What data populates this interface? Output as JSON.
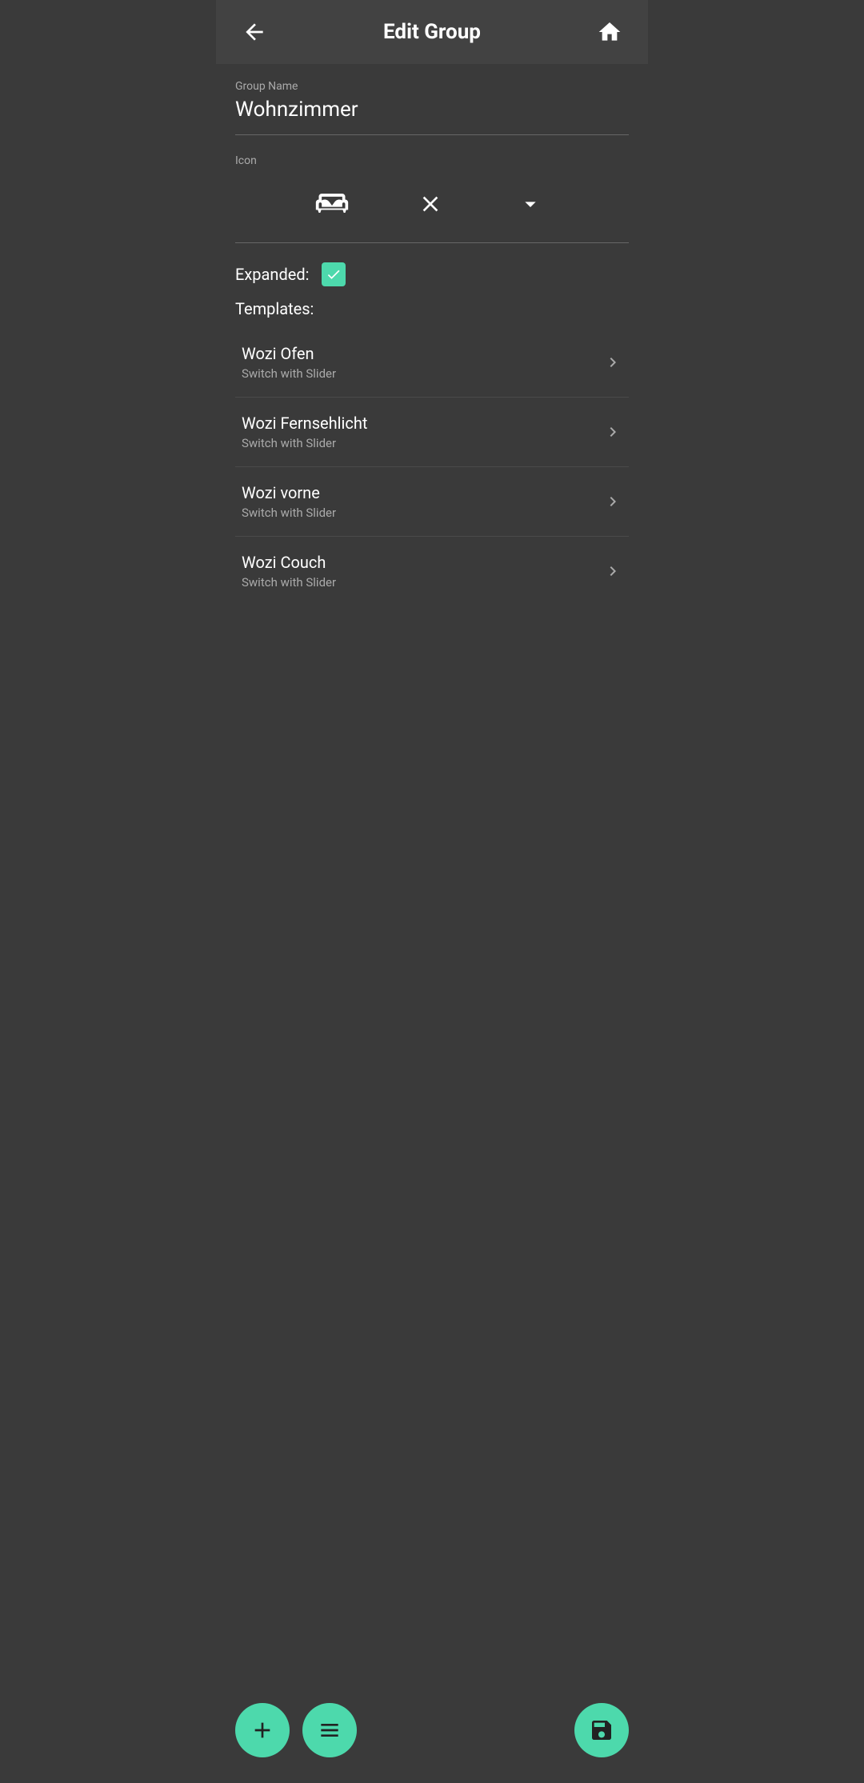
{
  "header": {
    "title": "Edit Group",
    "back_label": "back",
    "home_label": "home"
  },
  "form": {
    "group_name_label": "Group Name",
    "group_name_value": "Wohnzimmer",
    "icon_label": "Icon",
    "expanded_label": "Expanded:",
    "expanded_checked": true,
    "templates_label": "Templates:"
  },
  "templates": [
    {
      "name": "Wozi Ofen",
      "type": "Switch with Slider"
    },
    {
      "name": "Wozi Fernsehlicht",
      "type": "Switch with Slider"
    },
    {
      "name": "Wozi vorne",
      "type": "Switch with Slider"
    },
    {
      "name": "Wozi Couch",
      "type": "Switch with Slider"
    }
  ],
  "actions": {
    "add_label": "add",
    "group_label": "group",
    "save_label": "save"
  },
  "colors": {
    "accent": "#4dd9ac",
    "bg": "#3a3a3a",
    "header_bg": "#424242",
    "text_primary": "#ffffff",
    "text_secondary": "#aaaaaa"
  }
}
